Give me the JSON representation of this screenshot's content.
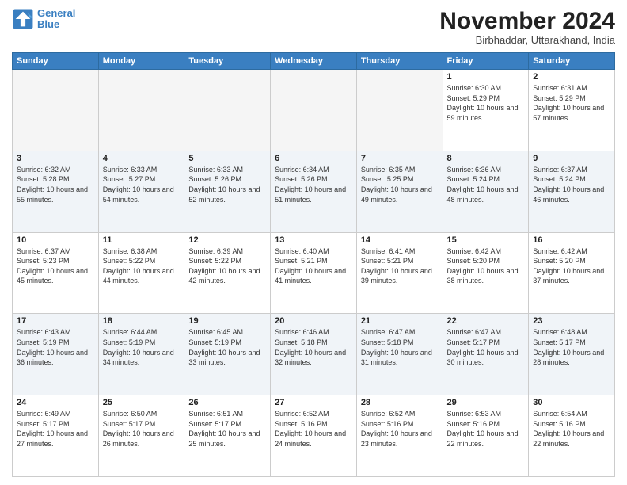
{
  "header": {
    "logo_line1": "General",
    "logo_line2": "Blue",
    "month": "November 2024",
    "location": "Birbhaddar, Uttarakhand, India"
  },
  "weekdays": [
    "Sunday",
    "Monday",
    "Tuesday",
    "Wednesday",
    "Thursday",
    "Friday",
    "Saturday"
  ],
  "weeks": [
    [
      {
        "day": "",
        "info": ""
      },
      {
        "day": "",
        "info": ""
      },
      {
        "day": "",
        "info": ""
      },
      {
        "day": "",
        "info": ""
      },
      {
        "day": "",
        "info": ""
      },
      {
        "day": "1",
        "info": "Sunrise: 6:30 AM\nSunset: 5:29 PM\nDaylight: 10 hours and 59 minutes."
      },
      {
        "day": "2",
        "info": "Sunrise: 6:31 AM\nSunset: 5:29 PM\nDaylight: 10 hours and 57 minutes."
      }
    ],
    [
      {
        "day": "3",
        "info": "Sunrise: 6:32 AM\nSunset: 5:28 PM\nDaylight: 10 hours and 55 minutes."
      },
      {
        "day": "4",
        "info": "Sunrise: 6:33 AM\nSunset: 5:27 PM\nDaylight: 10 hours and 54 minutes."
      },
      {
        "day": "5",
        "info": "Sunrise: 6:33 AM\nSunset: 5:26 PM\nDaylight: 10 hours and 52 minutes."
      },
      {
        "day": "6",
        "info": "Sunrise: 6:34 AM\nSunset: 5:26 PM\nDaylight: 10 hours and 51 minutes."
      },
      {
        "day": "7",
        "info": "Sunrise: 6:35 AM\nSunset: 5:25 PM\nDaylight: 10 hours and 49 minutes."
      },
      {
        "day": "8",
        "info": "Sunrise: 6:36 AM\nSunset: 5:24 PM\nDaylight: 10 hours and 48 minutes."
      },
      {
        "day": "9",
        "info": "Sunrise: 6:37 AM\nSunset: 5:24 PM\nDaylight: 10 hours and 46 minutes."
      }
    ],
    [
      {
        "day": "10",
        "info": "Sunrise: 6:37 AM\nSunset: 5:23 PM\nDaylight: 10 hours and 45 minutes."
      },
      {
        "day": "11",
        "info": "Sunrise: 6:38 AM\nSunset: 5:22 PM\nDaylight: 10 hours and 44 minutes."
      },
      {
        "day": "12",
        "info": "Sunrise: 6:39 AM\nSunset: 5:22 PM\nDaylight: 10 hours and 42 minutes."
      },
      {
        "day": "13",
        "info": "Sunrise: 6:40 AM\nSunset: 5:21 PM\nDaylight: 10 hours and 41 minutes."
      },
      {
        "day": "14",
        "info": "Sunrise: 6:41 AM\nSunset: 5:21 PM\nDaylight: 10 hours and 39 minutes."
      },
      {
        "day": "15",
        "info": "Sunrise: 6:42 AM\nSunset: 5:20 PM\nDaylight: 10 hours and 38 minutes."
      },
      {
        "day": "16",
        "info": "Sunrise: 6:42 AM\nSunset: 5:20 PM\nDaylight: 10 hours and 37 minutes."
      }
    ],
    [
      {
        "day": "17",
        "info": "Sunrise: 6:43 AM\nSunset: 5:19 PM\nDaylight: 10 hours and 36 minutes."
      },
      {
        "day": "18",
        "info": "Sunrise: 6:44 AM\nSunset: 5:19 PM\nDaylight: 10 hours and 34 minutes."
      },
      {
        "day": "19",
        "info": "Sunrise: 6:45 AM\nSunset: 5:19 PM\nDaylight: 10 hours and 33 minutes."
      },
      {
        "day": "20",
        "info": "Sunrise: 6:46 AM\nSunset: 5:18 PM\nDaylight: 10 hours and 32 minutes."
      },
      {
        "day": "21",
        "info": "Sunrise: 6:47 AM\nSunset: 5:18 PM\nDaylight: 10 hours and 31 minutes."
      },
      {
        "day": "22",
        "info": "Sunrise: 6:47 AM\nSunset: 5:17 PM\nDaylight: 10 hours and 30 minutes."
      },
      {
        "day": "23",
        "info": "Sunrise: 6:48 AM\nSunset: 5:17 PM\nDaylight: 10 hours and 28 minutes."
      }
    ],
    [
      {
        "day": "24",
        "info": "Sunrise: 6:49 AM\nSunset: 5:17 PM\nDaylight: 10 hours and 27 minutes."
      },
      {
        "day": "25",
        "info": "Sunrise: 6:50 AM\nSunset: 5:17 PM\nDaylight: 10 hours and 26 minutes."
      },
      {
        "day": "26",
        "info": "Sunrise: 6:51 AM\nSunset: 5:17 PM\nDaylight: 10 hours and 25 minutes."
      },
      {
        "day": "27",
        "info": "Sunrise: 6:52 AM\nSunset: 5:16 PM\nDaylight: 10 hours and 24 minutes."
      },
      {
        "day": "28",
        "info": "Sunrise: 6:52 AM\nSunset: 5:16 PM\nDaylight: 10 hours and 23 minutes."
      },
      {
        "day": "29",
        "info": "Sunrise: 6:53 AM\nSunset: 5:16 PM\nDaylight: 10 hours and 22 minutes."
      },
      {
        "day": "30",
        "info": "Sunrise: 6:54 AM\nSunset: 5:16 PM\nDaylight: 10 hours and 22 minutes."
      }
    ]
  ]
}
